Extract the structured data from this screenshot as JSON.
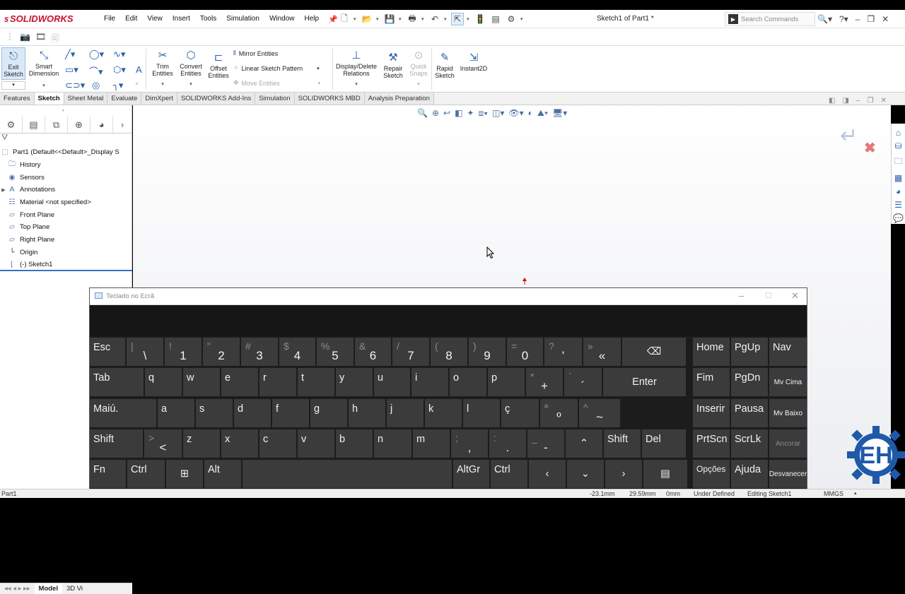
{
  "app": {
    "logo_text": "SOLIDWORKS",
    "menu": [
      "File",
      "Edit",
      "View",
      "Insert",
      "Tools",
      "Simulation",
      "Window",
      "Help"
    ],
    "document_title": "Sketch1 of Part1 *",
    "search_placeholder": "Search Commands"
  },
  "ribbon": {
    "exit_sketch": "Exit\nSketch",
    "smart_dimension": "Smart\nDimension",
    "trim_entities": "Trim\nEntities",
    "convert_entities": "Convert\nEntities",
    "offset_entities": "Offset\nEntities",
    "mirror_entities": "Mirror Entities",
    "linear_sketch_pattern": "Linear Sketch Pattern",
    "move_entities": "Move Entities",
    "display_delete_relations": "Display/Delete\nRelations",
    "repair_sketch": "Repair\nSketch",
    "quick_snaps": "Quick\nSnaps",
    "rapid_sketch": "Rapid\nSketch",
    "instant2d": "Instant2D"
  },
  "command_tabs": [
    "Features",
    "Sketch",
    "Sheet Metal",
    "Evaluate",
    "DimXpert",
    "SOLIDWORKS Add-Ins",
    "Simulation",
    "SOLIDWORKS MBD",
    "Analysis Preparation"
  ],
  "active_tab": "Sketch",
  "feature_tree": {
    "root": "Part1  (Default<<Default>_Display S",
    "items": [
      "History",
      "Sensors",
      "Annotations",
      "Material <not specified>",
      "Front Plane",
      "Top Plane",
      "Right Plane",
      "Origin",
      "(-) Sketch1"
    ]
  },
  "bottom_tabs": [
    "Model",
    "3D Vi"
  ],
  "status": {
    "part": "Part1",
    "x": "-23.1mm",
    "y": "29.59mm",
    "z": "0mm",
    "state": "Under Defined",
    "editing": "Editing Sketch1",
    "units": "MMGS"
  },
  "keyboard": {
    "title": "Teclado no Ecrã",
    "rows": [
      [
        {
          "p": "Esc"
        },
        {
          "s": "|",
          "m": "\\"
        },
        {
          "s": "!",
          "m": "1"
        },
        {
          "s": "\"",
          "m": "2"
        },
        {
          "s": "#",
          "m": "3"
        },
        {
          "s": "$",
          "m": "4"
        },
        {
          "s": "%",
          "m": "5"
        },
        {
          "s": "&",
          "m": "6"
        },
        {
          "s": "/",
          "m": "7"
        },
        {
          "s": "(",
          "m": "8"
        },
        {
          "s": ")",
          "m": "9"
        },
        {
          "s": "=",
          "m": "0"
        },
        {
          "s": "?",
          "m": "'"
        },
        {
          "s": "»",
          "m": "«"
        },
        {
          "c": "⌫"
        }
      ],
      [
        {
          "p": "Tab"
        },
        {
          "p": "q"
        },
        {
          "p": "w"
        },
        {
          "p": "e"
        },
        {
          "p": "r"
        },
        {
          "p": "t"
        },
        {
          "p": "y"
        },
        {
          "p": "u"
        },
        {
          "p": "i"
        },
        {
          "p": "o"
        },
        {
          "p": "p"
        },
        {
          "s": "*",
          "m": "+"
        },
        {
          "s": "`",
          "m": "´"
        },
        {
          "c": "Enter"
        }
      ],
      [
        {
          "p": "Maiú."
        },
        {
          "p": "a"
        },
        {
          "p": "s"
        },
        {
          "p": "d"
        },
        {
          "p": "f"
        },
        {
          "p": "g"
        },
        {
          "p": "h"
        },
        {
          "p": "j"
        },
        {
          "p": "k"
        },
        {
          "p": "l"
        },
        {
          "p": "ç"
        },
        {
          "s": "ª",
          "m": "º"
        },
        {
          "s": "^",
          "m": "~"
        }
      ],
      [
        {
          "p": "Shift"
        },
        {
          "s": ">",
          "m": "<"
        },
        {
          "p": "z"
        },
        {
          "p": "x"
        },
        {
          "p": "c"
        },
        {
          "p": "v"
        },
        {
          "p": "b"
        },
        {
          "p": "n"
        },
        {
          "p": "m"
        },
        {
          "s": ";",
          "m": ","
        },
        {
          "s": ":",
          "m": "."
        },
        {
          "s": "_",
          "m": "-"
        },
        {
          "c": "⌃"
        },
        {
          "p": "Shift"
        },
        {
          "p": "Del"
        }
      ],
      [
        {
          "p": "Fn"
        },
        {
          "p": "Ctrl"
        },
        {
          "c": "⊞"
        },
        {
          "p": "Alt"
        },
        {
          "c": ""
        },
        {
          "p": "AltGr"
        },
        {
          "p": "Ctrl"
        },
        {
          "c": "‹"
        },
        {
          "c": "⌄"
        },
        {
          "c": "›"
        },
        {
          "c": "▤"
        }
      ]
    ],
    "nav": [
      [
        "Home",
        "PgUp",
        "Nav"
      ],
      [
        "Fim",
        "PgDn",
        "Mv Cima"
      ],
      [
        "Inserir",
        "Pausa",
        "Mv Baixo"
      ],
      [
        "PrtScn",
        "ScrLk",
        "Ancorar"
      ],
      [
        "Opções",
        "Ajuda",
        "Desvanecer"
      ]
    ]
  },
  "colors": {
    "keyboard_bg": "#1c1c1c",
    "key_bg": "#3b3b3b",
    "accent": "#2a5fa8",
    "watermark": "#1e5aa8"
  }
}
